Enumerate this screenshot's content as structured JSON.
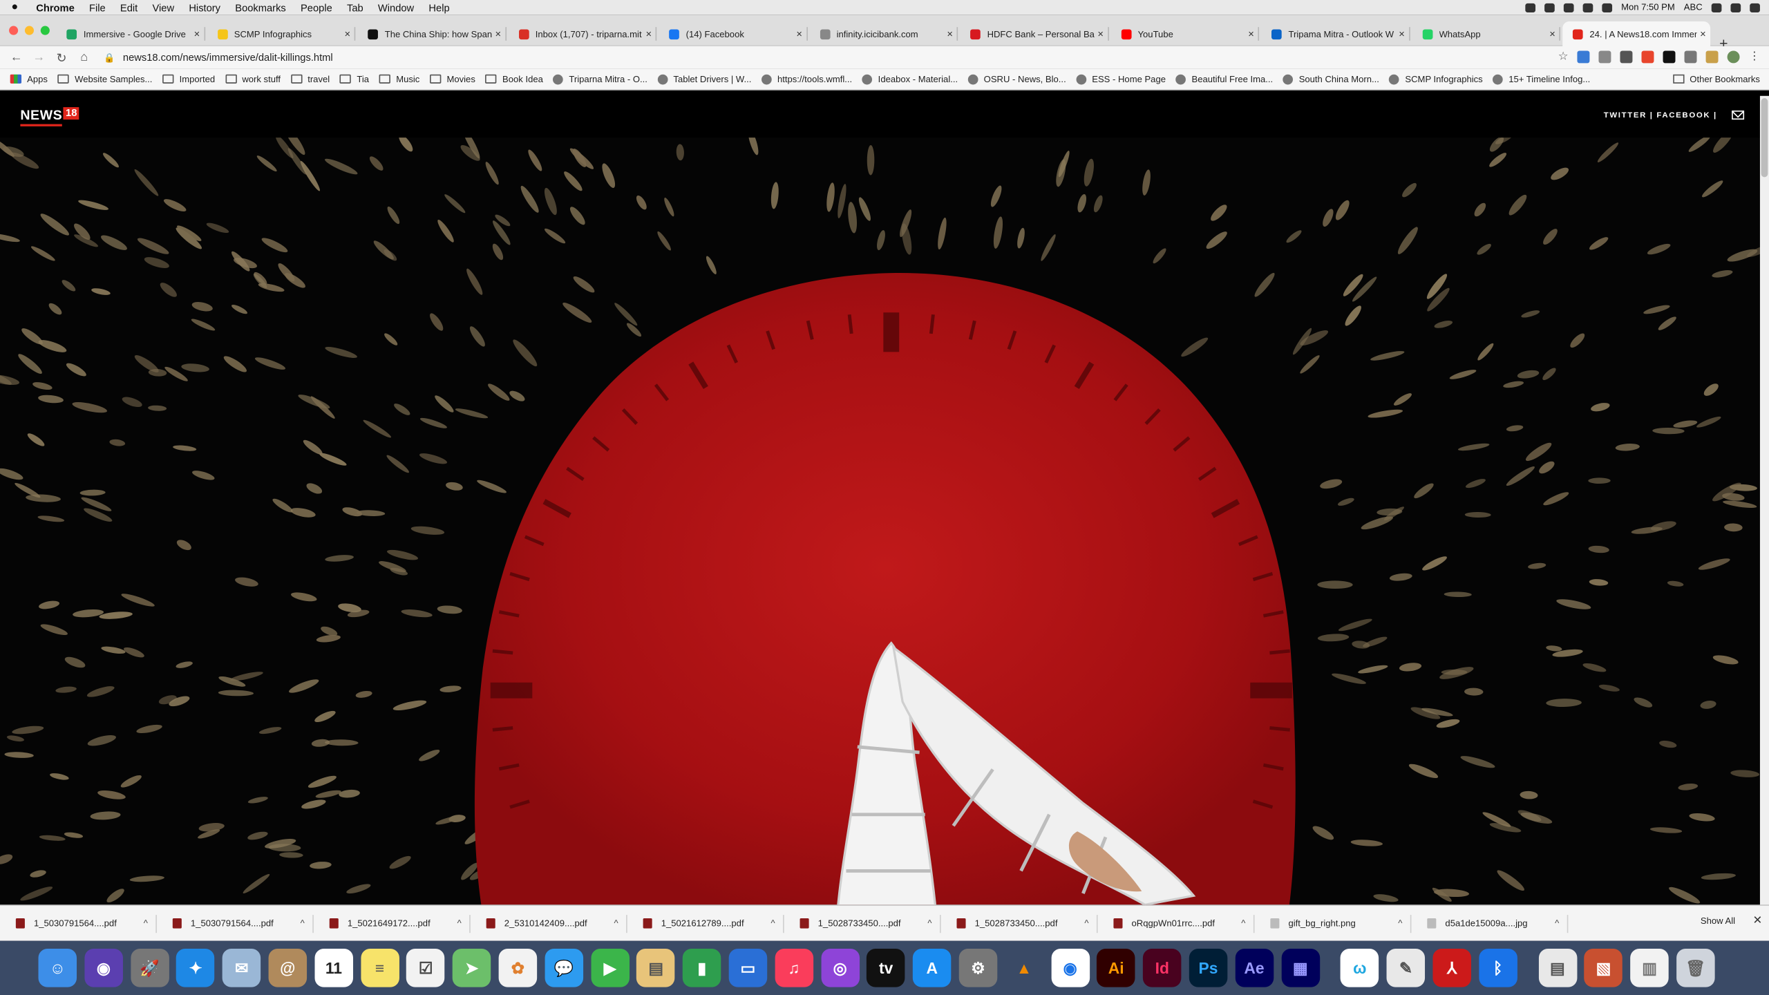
{
  "menubar": {
    "app": "Chrome",
    "items": [
      "File",
      "Edit",
      "View",
      "History",
      "Bookmarks",
      "People",
      "Tab",
      "Window",
      "Help"
    ],
    "clock": "Mon 7:50 PM",
    "input_source": "ABC"
  },
  "tabs": [
    {
      "title": "Immersive - Google Drive",
      "color": "#1fa463"
    },
    {
      "title": "SCMP Infographics",
      "color": "#f5c518"
    },
    {
      "title": "The China Ship: how Spani",
      "color": "#111111"
    },
    {
      "title": "Inbox (1,707) - triparna.mit",
      "color": "#d93025"
    },
    {
      "title": "(14) Facebook",
      "color": "#1877f2"
    },
    {
      "title": "infinity.icicibank.com",
      "color": "#888888"
    },
    {
      "title": "HDFC Bank – Personal Ban",
      "color": "#d71920"
    },
    {
      "title": "YouTube",
      "color": "#ff0000"
    },
    {
      "title": "Tripama Mitra - Outlook W",
      "color": "#0a64c8"
    },
    {
      "title": "WhatsApp",
      "color": "#25d366"
    },
    {
      "title": "24. | A News18.com Immer",
      "color": "#e1251b"
    }
  ],
  "toolbar": {
    "url": "news18.com/news/immersive/dalit-killings.html"
  },
  "bookmarks": [
    {
      "label": "Apps",
      "icon": "apps-icon"
    },
    {
      "label": "Website Samples...",
      "icon": "folder-icon"
    },
    {
      "label": "Imported",
      "icon": "folder-icon"
    },
    {
      "label": "work stuff",
      "icon": "folder-icon"
    },
    {
      "label": "travel",
      "icon": "folder-icon"
    },
    {
      "label": "Tia",
      "icon": "folder-icon"
    },
    {
      "label": "Music",
      "icon": "folder-icon"
    },
    {
      "label": "Movies",
      "icon": "folder-icon"
    },
    {
      "label": "Book Idea",
      "icon": "folder-icon"
    },
    {
      "label": "Triparna Mitra - O...",
      "icon": "outlook-icon"
    },
    {
      "label": "Tablet Drivers | W...",
      "icon": "wacom-icon"
    },
    {
      "label": "https://tools.wmfl...",
      "icon": "site-icon"
    },
    {
      "label": "Ideabox - Material...",
      "icon": "site-icon"
    },
    {
      "label": "OSRU - News, Blo...",
      "icon": "site-icon"
    },
    {
      "label": "ESS - Home Page",
      "icon": "site-icon"
    },
    {
      "label": "Beautiful Free Ima...",
      "icon": "site-icon"
    },
    {
      "label": "South China Morn...",
      "icon": "site-icon"
    },
    {
      "label": "SCMP Infographics",
      "icon": "site-icon"
    },
    {
      "label": "15+ Timeline Infog...",
      "icon": "site-icon"
    }
  ],
  "bookmarks_other": "Other Bookmarks",
  "page": {
    "logo_text": "NEWS",
    "logo_number": "18",
    "social": "TWITTER  |  FACEBOOK  |"
  },
  "downloads": [
    {
      "name": "1_5030791564....pdf",
      "type": "pdf"
    },
    {
      "name": "1_5030791564....pdf",
      "type": "pdf"
    },
    {
      "name": "1_5021649172....pdf",
      "type": "pdf"
    },
    {
      "name": "2_5310142409....pdf",
      "type": "pdf"
    },
    {
      "name": "1_5021612789....pdf",
      "type": "pdf"
    },
    {
      "name": "1_5028733450....pdf",
      "type": "pdf"
    },
    {
      "name": "1_5028733450....pdf",
      "type": "pdf"
    },
    {
      "name": "oRqgpWn01rrc....pdf",
      "type": "pdf"
    },
    {
      "name": "gift_bg_right.png",
      "type": "img"
    },
    {
      "name": "d5a1de15009a....jpg",
      "type": "img"
    }
  ],
  "downloads_show_all": "Show All",
  "dock": [
    {
      "name": "finder-icon",
      "bg": "#3d8ee8",
      "glyph": "☺"
    },
    {
      "name": "siri-icon",
      "bg": "#5b3fb0",
      "glyph": "◉"
    },
    {
      "name": "launchpad-icon",
      "bg": "#777777",
      "glyph": "🚀"
    },
    {
      "name": "safari-icon",
      "bg": "#1e88e5",
      "glyph": "✦"
    },
    {
      "name": "mail-stamp-icon",
      "bg": "#9ab7d6",
      "glyph": "✉"
    },
    {
      "name": "contacts-icon",
      "bg": "#b08a5c",
      "glyph": "@"
    },
    {
      "name": "calendar-icon",
      "bg": "#ffffff",
      "glyph": "11",
      "fg": "#222"
    },
    {
      "name": "notes-icon",
      "bg": "#f7e36a",
      "glyph": "≡",
      "fg": "#555"
    },
    {
      "name": "reminders-icon",
      "bg": "#f2f2f2",
      "glyph": "☑",
      "fg": "#444"
    },
    {
      "name": "maps-icon",
      "bg": "#6cbf6a",
      "glyph": "➤"
    },
    {
      "name": "photos-icon",
      "bg": "#f2f2f2",
      "glyph": "✿",
      "fg": "#e08030"
    },
    {
      "name": "messages-icon",
      "bg": "#2d9bf0",
      "glyph": "💬"
    },
    {
      "name": "facetime-icon",
      "bg": "#3bb54a",
      "glyph": "▶"
    },
    {
      "name": "preview-icon",
      "bg": "#e8c47a",
      "glyph": "▤",
      "fg": "#555"
    },
    {
      "name": "numbers-icon",
      "bg": "#2e9e4e",
      "glyph": "▮"
    },
    {
      "name": "keynote-icon",
      "bg": "#2a6fd6",
      "glyph": "▭"
    },
    {
      "name": "music-icon",
      "bg": "#fa3d5b",
      "glyph": "♫"
    },
    {
      "name": "podcasts-icon",
      "bg": "#8e44d8",
      "glyph": "◎"
    },
    {
      "name": "apple-tv-icon",
      "bg": "#111111",
      "glyph": "tv"
    },
    {
      "name": "app-store-icon",
      "bg": "#1a8cf0",
      "glyph": "A"
    },
    {
      "name": "system-preferences-icon",
      "bg": "#777777",
      "glyph": "⚙"
    },
    {
      "name": "vlc-icon",
      "bg": "#3a4a66",
      "glyph": "▲",
      "fg": "#f08a00"
    },
    {
      "name": "chrome-icon",
      "bg": "#ffffff",
      "glyph": "◉",
      "fg": "#1a73e8"
    },
    {
      "name": "illustrator-icon",
      "bg": "#300000",
      "glyph": "Ai",
      "fg": "#ff9a00"
    },
    {
      "name": "indesign-icon",
      "bg": "#49021f",
      "glyph": "Id",
      "fg": "#ff3366"
    },
    {
      "name": "photoshop-icon",
      "bg": "#001e36",
      "glyph": "Ps",
      "fg": "#31a8ff"
    },
    {
      "name": "after-effects-icon",
      "bg": "#00005b",
      "glyph": "Ae",
      "fg": "#9999ff"
    },
    {
      "name": "media-encoder-icon",
      "bg": "#00005b",
      "glyph": "▦",
      "fg": "#9999ff"
    },
    {
      "name": "webex-icon",
      "bg": "#ffffff",
      "glyph": "ω",
      "fg": "#1ea7e0"
    },
    {
      "name": "textedit-icon",
      "bg": "#e8e8e8",
      "glyph": "✎",
      "fg": "#555"
    },
    {
      "name": "acrobat-icon",
      "bg": "#cc1a1a",
      "glyph": "⅄"
    },
    {
      "name": "bluetooth-icon",
      "bg": "#1a73e8",
      "glyph": "ᛒ"
    },
    {
      "name": "downloads-stack-icon",
      "bg": "#e8e8e8",
      "glyph": "▤",
      "fg": "#555"
    },
    {
      "name": "screenshot-stack-icon",
      "bg": "#c85030",
      "glyph": "▧"
    },
    {
      "name": "documents-stack-icon",
      "bg": "#f2f2f2",
      "glyph": "▥",
      "fg": "#777"
    },
    {
      "name": "trash-icon",
      "bg": "#cfd4dc",
      "glyph": "🗑",
      "fg": "#666"
    }
  ]
}
